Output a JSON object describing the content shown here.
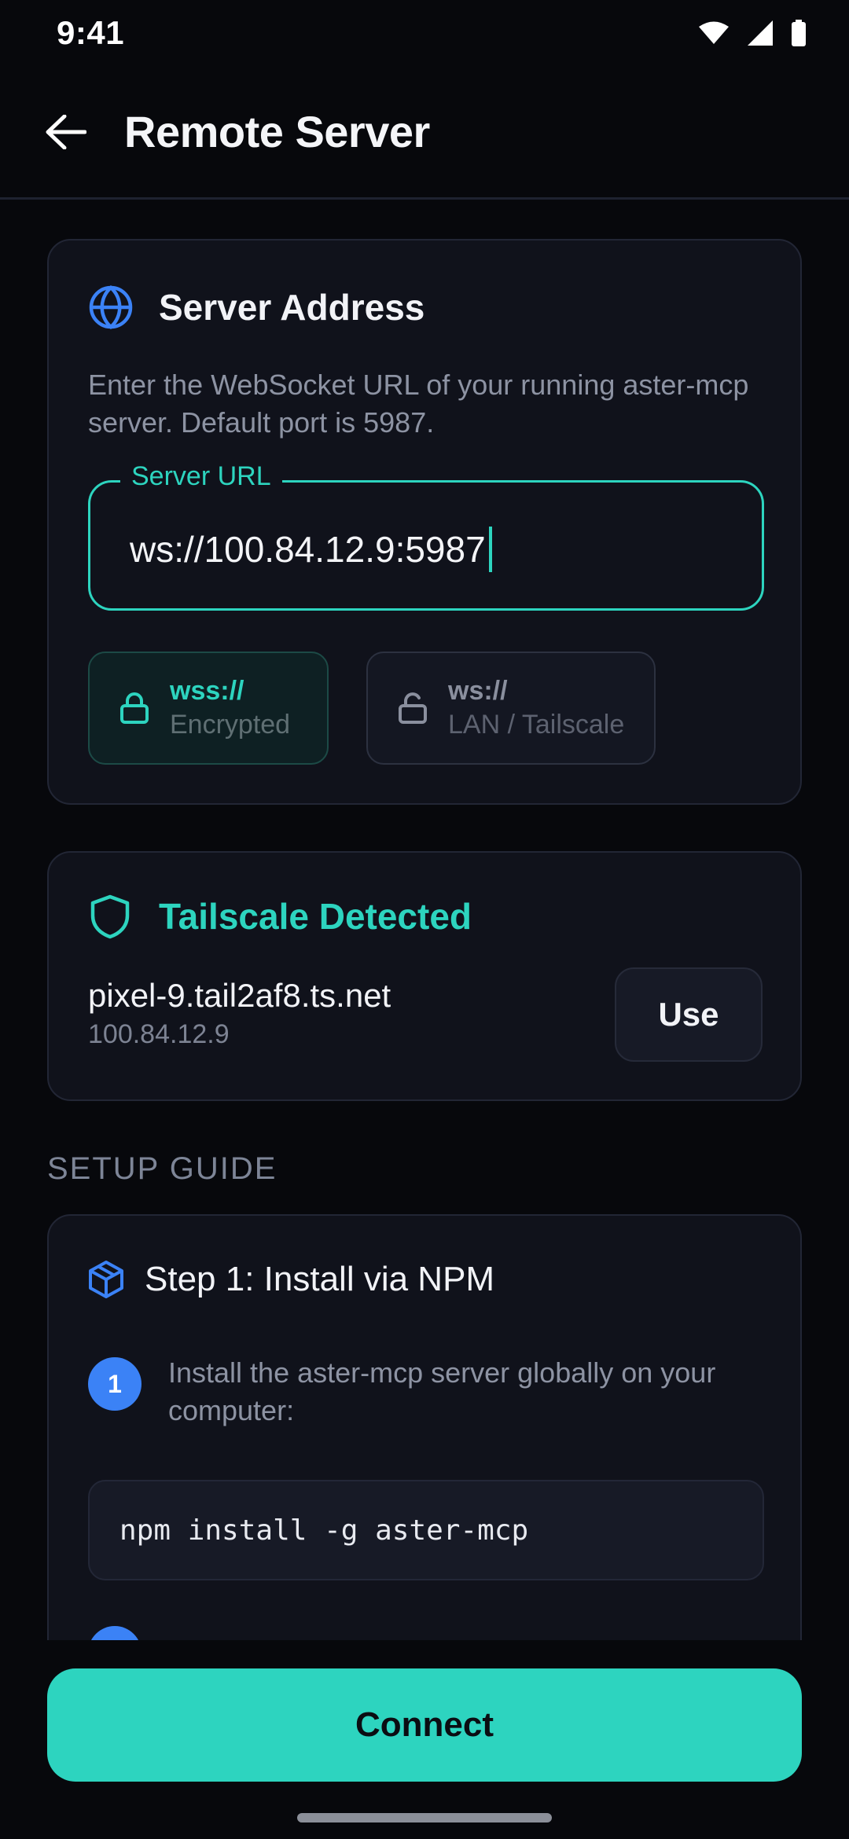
{
  "status_bar": {
    "time": "9:41",
    "icons": [
      "wifi-icon",
      "signal-icon",
      "battery-icon"
    ]
  },
  "app_bar": {
    "back_icon": "arrow-left-icon",
    "title": "Remote Server"
  },
  "server_address": {
    "icon": "globe-icon",
    "title": "Server Address",
    "description": "Enter the WebSocket URL of your running aster-mcp server. Default port is 5987.",
    "url_field": {
      "label": "Server URL",
      "value": "ws://100.84.12.9:5987"
    },
    "protocols": [
      {
        "icon": "lock-closed-icon",
        "title": "wss://",
        "subtitle": "Encrypted",
        "selected": true
      },
      {
        "icon": "lock-open-icon",
        "title": "ws://",
        "subtitle": "LAN / Tailscale",
        "selected": false
      }
    ]
  },
  "tailscale": {
    "icon": "shield-icon",
    "title": "Tailscale Detected",
    "hostname": "pixel-9.tail2af8.ts.net",
    "ip": "100.84.12.9",
    "use_label": "Use"
  },
  "setup_guide": {
    "section_label": "SETUP GUIDE",
    "step1": {
      "icon": "package-icon",
      "title": "Step 1: Install via NPM",
      "items": [
        {
          "number": "1",
          "text": "Install the aster-mcp server globally on your computer:"
        }
      ],
      "code": "npm install -g aster-mcp"
    }
  },
  "connect_label": "Connect",
  "colors": {
    "accent": "#2dd4bf",
    "step_badge": "#3b82f6",
    "background": "#07080c",
    "card": "#10121b"
  }
}
